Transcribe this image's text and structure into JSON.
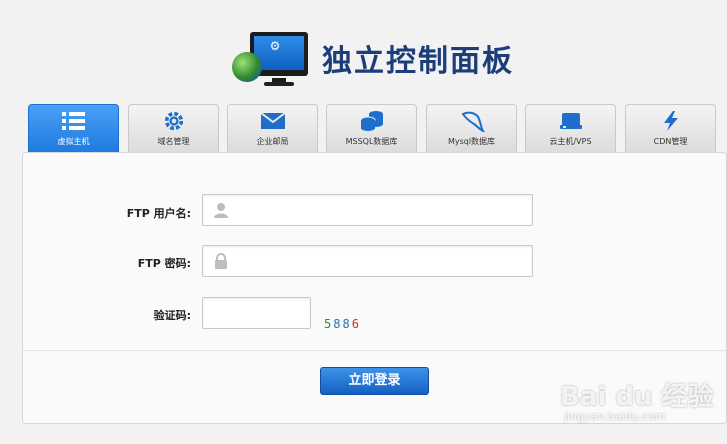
{
  "header": {
    "title": "独立控制面板",
    "logo_icon": "monitor-globe-icon"
  },
  "tabs": [
    {
      "label": "虚拟主机",
      "icon": "list-icon",
      "active": true
    },
    {
      "label": "域名管理",
      "icon": "gear-icon",
      "active": false
    },
    {
      "label": "企业邮局",
      "icon": "envelope-icon",
      "active": false
    },
    {
      "label": "MSSQL数据库",
      "icon": "database-icon",
      "active": false
    },
    {
      "label": "Mysql数据库",
      "icon": "dolphin-icon",
      "active": false
    },
    {
      "label": "云主机/VPS",
      "icon": "server-icon",
      "active": false
    },
    {
      "label": "CDN管理",
      "icon": "lightning-icon",
      "active": false
    }
  ],
  "form": {
    "username_label": "FTP 用户名:",
    "username_value": "",
    "password_label": "FTP 密码:",
    "password_value": "",
    "captcha_label": "验证码:",
    "captcha_value": "",
    "captcha_code": [
      "5",
      "8",
      "8",
      "6"
    ],
    "captcha_colors": [
      "#2a8a4a",
      "#2a6fb0",
      "#2a6fb0",
      "#c0392b"
    ],
    "submit_label": "立即登录"
  },
  "watermark": {
    "main": "Bai du 经验",
    "sub": "jingyan.baidu.com"
  },
  "colors": {
    "accent": "#1e7be0",
    "title": "#1d3d7a",
    "tab_icon": "#1e6fcc"
  }
}
